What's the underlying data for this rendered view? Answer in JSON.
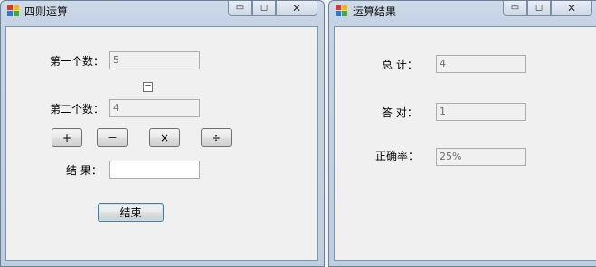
{
  "window1": {
    "title": "四则运算",
    "controls": {
      "minimize": "▭",
      "maximize": "◻",
      "close": "✕"
    },
    "first_label": "第一个数：",
    "first_value": "5",
    "operator_display": "－",
    "second_label": "第二个数：",
    "second_value": "4",
    "op_buttons": [
      "+",
      "－",
      "×",
      "÷"
    ],
    "result_label": "结 果：",
    "result_value": "",
    "end_button": "结束"
  },
  "window2": {
    "title": "运算结果",
    "controls": {
      "minimize": "▭",
      "maximize": "◻",
      "close": "✕"
    },
    "total_label": "总 计：",
    "total_value": "4",
    "correct_label": "答 对：",
    "correct_value": "1",
    "rate_label": "正确率：",
    "rate_value": "25%"
  },
  "colors": {
    "frame": "#c5d3e4",
    "client": "#f0f0f0",
    "default_button_border": "#3c7fb1"
  }
}
